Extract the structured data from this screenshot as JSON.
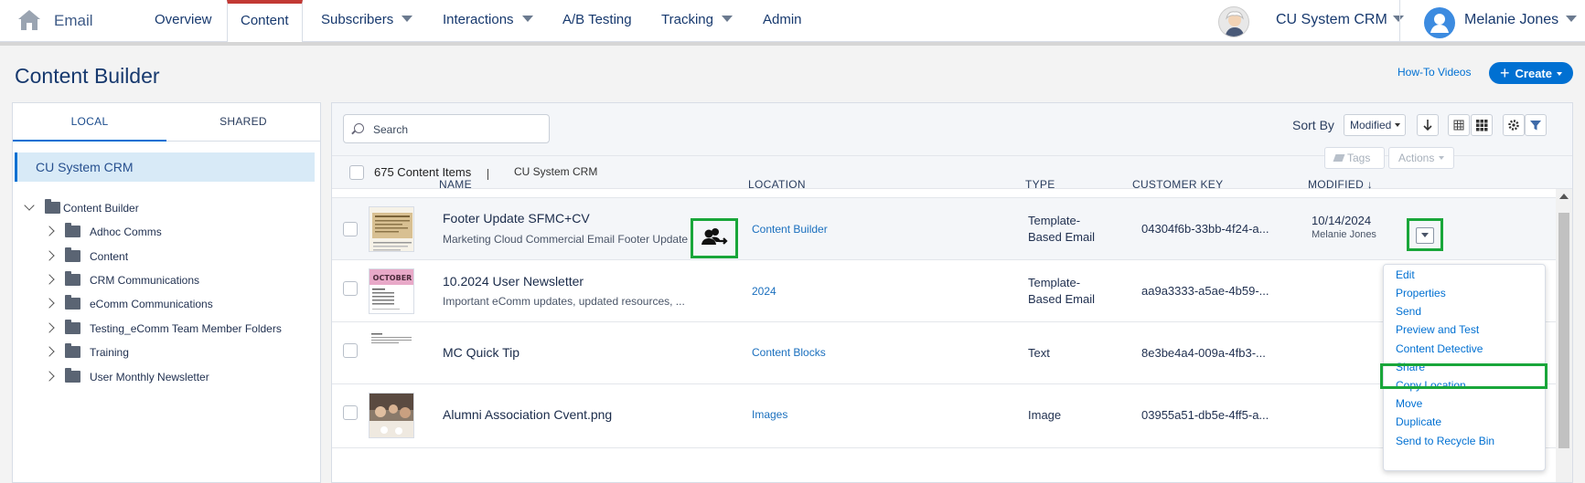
{
  "app": {
    "name": "Email"
  },
  "nav": {
    "items": [
      {
        "label": "Overview"
      },
      {
        "label": "Content"
      },
      {
        "label": "Subscribers"
      },
      {
        "label": "Interactions"
      },
      {
        "label": "A/B Testing"
      },
      {
        "label": "Tracking"
      },
      {
        "label": "Admin"
      }
    ],
    "active": "Content"
  },
  "account": {
    "org_name": "CU System CRM",
    "user_name": "Melanie Jones"
  },
  "page": {
    "title": "Content Builder",
    "howto_label": "How-To Videos",
    "create_label": "Create"
  },
  "left_panel": {
    "tabs": [
      {
        "label": "LOCAL"
      },
      {
        "label": "SHARED"
      }
    ],
    "selected": "CU System CRM",
    "tree": {
      "root": "Content Builder",
      "children": [
        "Adhoc Comms",
        "Content",
        "CRM Communications",
        "eComm Communications",
        "Testing_eComm Team Member Folders",
        "Training",
        "User Monthly Newsletter"
      ]
    }
  },
  "toolbar": {
    "search_placeholder": "Search",
    "sort_by_label": "Sort By",
    "sort_value": "Modified",
    "icons": [
      "sort-direction-icon",
      "list-view-icon",
      "grid-view-icon",
      "settings-icon",
      "filter-icon"
    ]
  },
  "info_bar": {
    "count_label": "675 Content Items",
    "breadcrumb": "CU System CRM",
    "tags_label": "Tags",
    "actions_label": "Actions"
  },
  "table": {
    "headers": [
      "NAME",
      "LOCATION",
      "TYPE",
      "CUSTOMER KEY",
      "MODIFIED ↓"
    ],
    "rows": [
      {
        "name": "Footer Update SFMC+CV",
        "description": "Marketing Cloud Commercial Email Footer Update",
        "location": "Content Builder",
        "type_line1": "Template-",
        "type_line2": "Based Email",
        "customer_key": "04304f6b-33bb-4f24-a...",
        "modified": "10/14/2024",
        "modified_by": "Melanie Jones"
      },
      {
        "name": "10.2024 User Newsletter",
        "description": "Important eComm updates, updated resources, ...",
        "location": "2024",
        "type_line1": "Template-",
        "type_line2": "Based Email",
        "customer_key": "aa9a3333-a5ae-4b59-..."
      },
      {
        "name": "MC Quick Tip",
        "location": "Content Blocks",
        "type_line1": "Text",
        "customer_key": "8e3be4a4-009a-4fb3-..."
      },
      {
        "name": "Alumni Association Cvent.png",
        "location": "Images",
        "type_line1": "Image",
        "customer_key": "03955a51-db5e-4ff5-a..."
      }
    ]
  },
  "context_menu": {
    "items": [
      "Edit",
      "Properties",
      "Send",
      "Preview and Test",
      "Content Detective",
      "Share",
      "Copy Location",
      "Move",
      "Duplicate",
      "Send to Recycle Bin"
    ],
    "highlighted": "Share"
  },
  "thumbnails": {
    "row2_banner_text": "OCTOBER"
  },
  "colors": {
    "accent": "#0070d2",
    "nav_active": "#c23934",
    "highlight_box": "#19a63a",
    "link": "#1a6fbe"
  }
}
